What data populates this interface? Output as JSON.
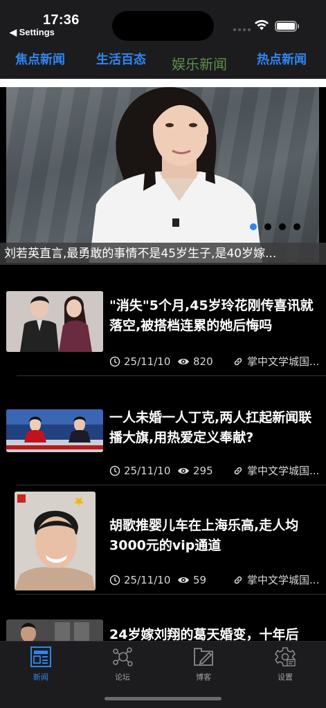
{
  "status_bar": {
    "time": "17:36",
    "back_label": "◀ Settings"
  },
  "tabs": [
    {
      "label": "焦点新闻",
      "active": false
    },
    {
      "label": "生活百态",
      "active": false
    },
    {
      "label": "娱乐新闻",
      "active": true
    },
    {
      "label": "热点新闻",
      "active": false
    }
  ],
  "banner": {
    "caption": "刘若英直言,最勇敢的事情不是45岁生子,是40岁嫁...",
    "page_count": 4,
    "current_page": 1
  },
  "news": [
    {
      "title": "\"消失\"5个月,45岁玲花刚传喜讯就落空,被搭档连累的她后悔吗",
      "date": "25/11/10",
      "views": "820",
      "source": "掌中文学城国..."
    },
    {
      "title": "一人未婚一人丁克,两人扛起新闻联播大旗,用热爱定义奉献?",
      "date": "25/11/10",
      "views": "295",
      "source": "掌中文学城国..."
    },
    {
      "title": "胡歌推婴儿车在上海乐高,走人均3000元的vip通道",
      "date": "25/11/10",
      "views": "59",
      "source": "掌中文学城国..."
    },
    {
      "title": "24岁嫁刘翔的葛天婚变，十年后"
    }
  ],
  "bottom_tabs": [
    {
      "label": "新闻",
      "icon": "news-icon",
      "active": true
    },
    {
      "label": "论坛",
      "icon": "forum-icon",
      "active": false
    },
    {
      "label": "博客",
      "icon": "blog-icon",
      "active": false
    },
    {
      "label": "设置",
      "icon": "settings-icon",
      "active": false
    }
  ],
  "colors": {
    "accent": "#2f86f0",
    "active_category": "#5f8f4a",
    "bar_bg": "#1c1c1e"
  }
}
